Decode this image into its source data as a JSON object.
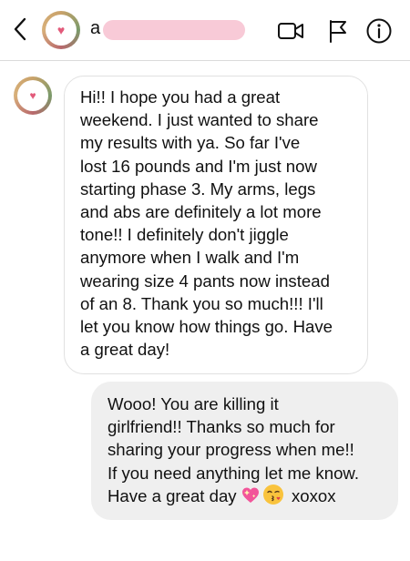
{
  "header": {
    "username_visible": "a"
  },
  "messages": [
    {
      "direction": "received",
      "lines": [
        "Hi!!  I hope you had a great",
        "weekend.  I just wanted to share",
        "my results  with ya.  So far I've",
        "lost 16 pounds and I'm just now",
        "starting phase 3.  My arms, legs",
        "and abs are definitely a lot more",
        "tone!!  I definitely don't jiggle",
        "anymore when I walk and I'm",
        "wearing size 4 pants now instead",
        "of an 8.  Thank you so much!!!  I'll",
        "let you know how things go. Have",
        "a great day!"
      ]
    },
    {
      "direction": "sent",
      "lines": [
        "Wooo!  You are killing it",
        "girlfriend!!  Thanks so much for",
        "sharing your progress when me!!",
        "If you need anything let me know.",
        "Have a great day"
      ],
      "last_line_suffix": "xoxox",
      "emojis": [
        "sparkling-heart-emoji",
        "face-blowing-kiss-emoji"
      ]
    }
  ],
  "icons": {
    "back": "chevron-left-icon",
    "video": "video-camera-icon",
    "flag": "flag-icon",
    "info": "info-icon",
    "avatar": "heart-avatar"
  },
  "colors": {
    "accent_pink": "#e25a7a",
    "redaction": "#f8cad7",
    "sent_bubble": "#efefef",
    "received_border": "#e1e1e1"
  }
}
